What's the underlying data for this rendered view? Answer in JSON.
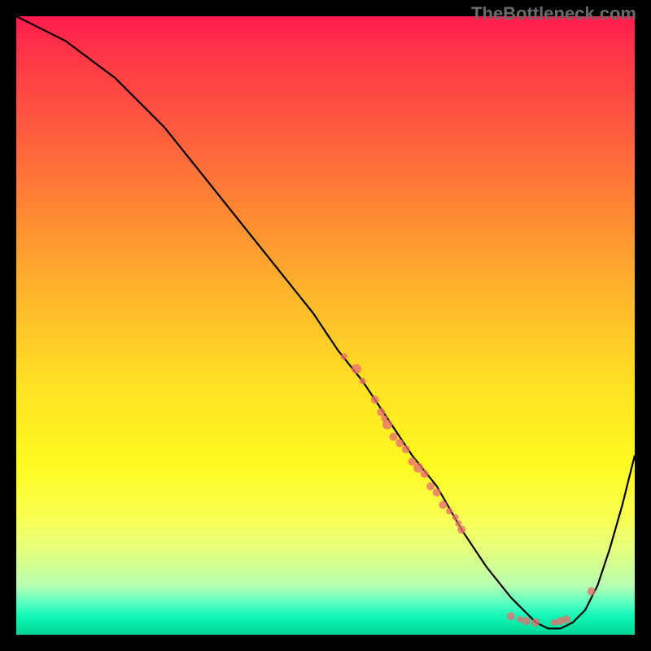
{
  "watermark": "TheBottleneck.com",
  "chart_data": {
    "type": "line",
    "title": "",
    "xlabel": "",
    "ylabel": "",
    "xlim": [
      0,
      100
    ],
    "ylim": [
      0,
      100
    ],
    "grid": false,
    "legend": false,
    "series": [
      {
        "name": "bottleneck-curve",
        "x": [
          0,
          4,
          8,
          12,
          16,
          20,
          24,
          28,
          32,
          36,
          40,
          44,
          48,
          52,
          56,
          60,
          64,
          68,
          72,
          76,
          80,
          82,
          84,
          86,
          88,
          90,
          92,
          94,
          96,
          98,
          100
        ],
        "y": [
          100,
          98,
          96,
          93,
          90,
          86,
          82,
          77,
          72,
          67,
          62,
          57,
          52,
          46,
          41,
          35,
          29,
          24,
          17,
          11,
          6,
          4,
          2,
          1,
          1,
          2,
          4,
          8,
          14,
          21,
          29
        ]
      }
    ],
    "scatter_points": {
      "name": "data-points",
      "points": [
        {
          "x": 53,
          "y": 45,
          "r": 4
        },
        {
          "x": 55,
          "y": 43,
          "r": 6
        },
        {
          "x": 56,
          "y": 41,
          "r": 4
        },
        {
          "x": 58,
          "y": 38,
          "r": 5
        },
        {
          "x": 59,
          "y": 36,
          "r": 5
        },
        {
          "x": 59.5,
          "y": 35,
          "r": 4
        },
        {
          "x": 60,
          "y": 34,
          "r": 6
        },
        {
          "x": 61,
          "y": 32,
          "r": 5
        },
        {
          "x": 62,
          "y": 31,
          "r": 5
        },
        {
          "x": 63,
          "y": 30,
          "r": 5
        },
        {
          "x": 64,
          "y": 28,
          "r": 5
        },
        {
          "x": 65,
          "y": 27,
          "r": 6
        },
        {
          "x": 66,
          "y": 26,
          "r": 5
        },
        {
          "x": 67,
          "y": 24,
          "r": 5
        },
        {
          "x": 68,
          "y": 23,
          "r": 5
        },
        {
          "x": 69,
          "y": 21,
          "r": 5
        },
        {
          "x": 70,
          "y": 20,
          "r": 4
        },
        {
          "x": 71,
          "y": 19,
          "r": 4
        },
        {
          "x": 71.5,
          "y": 18,
          "r": 4
        },
        {
          "x": 72,
          "y": 17,
          "r": 5
        },
        {
          "x": 80,
          "y": 3,
          "r": 5
        },
        {
          "x": 81.5,
          "y": 2.5,
          "r": 4
        },
        {
          "x": 82.5,
          "y": 2.2,
          "r": 5
        },
        {
          "x": 84,
          "y": 2,
          "r": 5
        },
        {
          "x": 87,
          "y": 2,
          "r": 4
        },
        {
          "x": 88,
          "y": 2.2,
          "r": 5
        },
        {
          "x": 89,
          "y": 2.5,
          "r": 5
        },
        {
          "x": 93,
          "y": 7,
          "r": 5
        }
      ]
    },
    "gradient_colors": {
      "top": "#ff1a4e",
      "mid_upper": "#ffb92b",
      "mid": "#fff91f",
      "mid_lower": "#b8ffb2",
      "bottom": "#03d396"
    }
  }
}
